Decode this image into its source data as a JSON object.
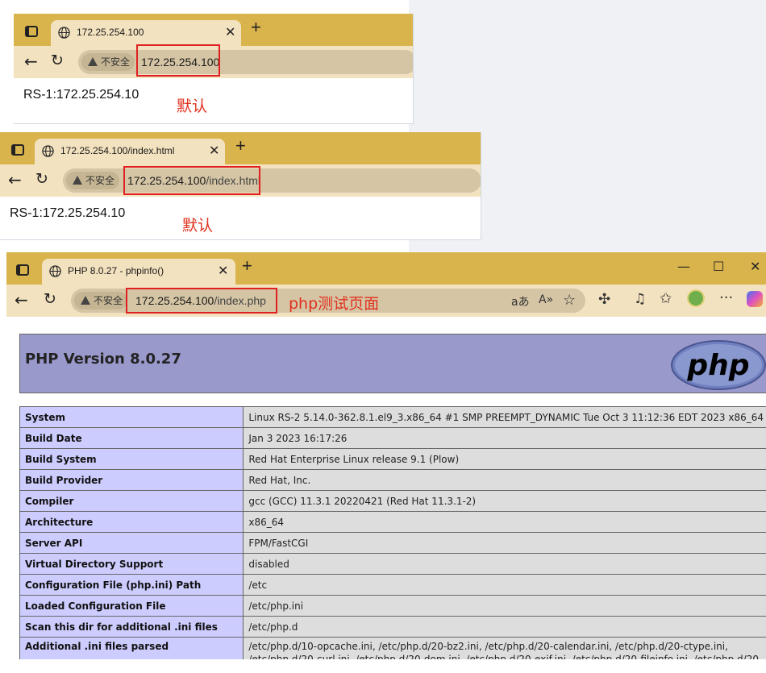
{
  "window1": {
    "tab_title": "172.25.254.100",
    "not_secure": "不安全",
    "url": "172.25.254.100",
    "content": "RS-1:172.25.254.10",
    "annotation": "默认"
  },
  "window2": {
    "tab_title": "172.25.254.100/index.html",
    "not_secure": "不安全",
    "url_host": "172.25.254.100",
    "url_path": "/index.html",
    "content": "RS-1:172.25.254.10",
    "annotation": "默认"
  },
  "window3": {
    "tab_title": "PHP 8.0.27 - phpinfo()",
    "not_secure": "不安全",
    "url_host": "172.25.254.100",
    "url_path": "/index.php",
    "annotation": "php测试页面",
    "php_version": "PHP Version 8.0.27",
    "logo_text": "php",
    "rows": [
      {
        "key": "System",
        "value": "Linux RS-2 5.14.0-362.8.1.el9_3.x86_64 #1 SMP PREEMPT_DYNAMIC Tue Oct 3 11:12:36 EDT 2023 x86_64"
      },
      {
        "key": "Build Date",
        "value": "Jan 3 2023 16:17:26"
      },
      {
        "key": "Build System",
        "value": "Red Hat Enterprise Linux release 9.1 (Plow)"
      },
      {
        "key": "Build Provider",
        "value": "Red Hat, Inc."
      },
      {
        "key": "Compiler",
        "value": "gcc (GCC) 11.3.1 20220421 (Red Hat 11.3.1-2)"
      },
      {
        "key": "Architecture",
        "value": "x86_64"
      },
      {
        "key": "Server API",
        "value": "FPM/FastCGI"
      },
      {
        "key": "Virtual Directory Support",
        "value": "disabled"
      },
      {
        "key": "Configuration File (php.ini) Path",
        "value": "/etc"
      },
      {
        "key": "Loaded Configuration File",
        "value": "/etc/php.ini"
      },
      {
        "key": "Scan this dir for additional .ini files",
        "value": "/etc/php.d"
      },
      {
        "key": "Additional .ini files parsed",
        "value": "/etc/php.d/10-opcache.ini, /etc/php.d/20-bz2.ini, /etc/php.d/20-calendar.ini, /etc/php.d/20-ctype.ini,",
        "value2": "/etc/php.d/20-curl.ini, /etc/php.d/20-dom.ini, /etc/php.d/20-exif.ini, /etc/php.d/20-fileinfo.ini, /etc/php.d/20-"
      }
    ]
  }
}
